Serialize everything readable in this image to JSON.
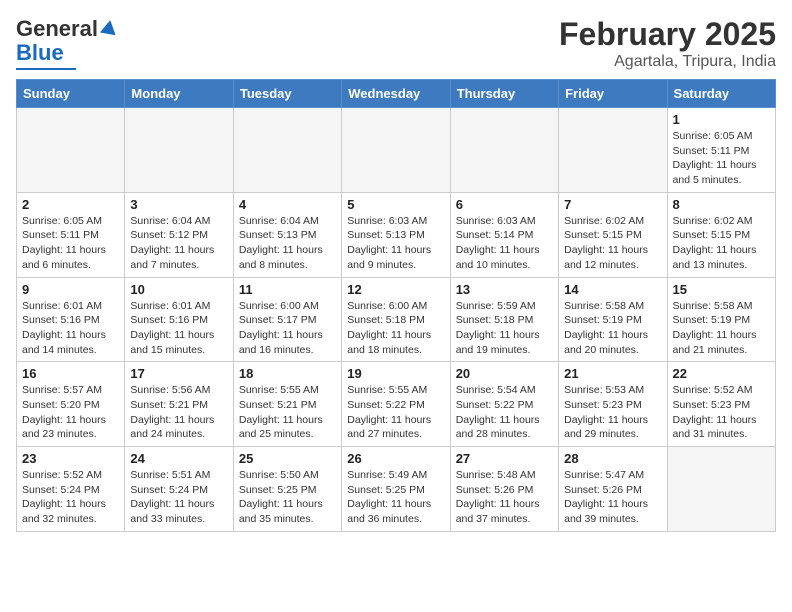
{
  "header": {
    "logo_general": "General",
    "logo_blue": "Blue",
    "month_year": "February 2025",
    "location": "Agartala, Tripura, India"
  },
  "weekdays": [
    "Sunday",
    "Monday",
    "Tuesday",
    "Wednesday",
    "Thursday",
    "Friday",
    "Saturday"
  ],
  "weeks": [
    [
      {
        "day": "",
        "info": ""
      },
      {
        "day": "",
        "info": ""
      },
      {
        "day": "",
        "info": ""
      },
      {
        "day": "",
        "info": ""
      },
      {
        "day": "",
        "info": ""
      },
      {
        "day": "",
        "info": ""
      },
      {
        "day": "1",
        "info": "Sunrise: 6:05 AM\nSunset: 5:11 PM\nDaylight: 11 hours and 5 minutes."
      }
    ],
    [
      {
        "day": "2",
        "info": "Sunrise: 6:05 AM\nSunset: 5:11 PM\nDaylight: 11 hours and 6 minutes."
      },
      {
        "day": "3",
        "info": "Sunrise: 6:04 AM\nSunset: 5:12 PM\nDaylight: 11 hours and 7 minutes."
      },
      {
        "day": "4",
        "info": "Sunrise: 6:04 AM\nSunset: 5:13 PM\nDaylight: 11 hours and 8 minutes."
      },
      {
        "day": "5",
        "info": "Sunrise: 6:03 AM\nSunset: 5:13 PM\nDaylight: 11 hours and 9 minutes."
      },
      {
        "day": "6",
        "info": "Sunrise: 6:03 AM\nSunset: 5:14 PM\nDaylight: 11 hours and 10 minutes."
      },
      {
        "day": "7",
        "info": "Sunrise: 6:02 AM\nSunset: 5:15 PM\nDaylight: 11 hours and 12 minutes."
      },
      {
        "day": "8",
        "info": "Sunrise: 6:02 AM\nSunset: 5:15 PM\nDaylight: 11 hours and 13 minutes."
      }
    ],
    [
      {
        "day": "9",
        "info": "Sunrise: 6:01 AM\nSunset: 5:16 PM\nDaylight: 11 hours and 14 minutes."
      },
      {
        "day": "10",
        "info": "Sunrise: 6:01 AM\nSunset: 5:16 PM\nDaylight: 11 hours and 15 minutes."
      },
      {
        "day": "11",
        "info": "Sunrise: 6:00 AM\nSunset: 5:17 PM\nDaylight: 11 hours and 16 minutes."
      },
      {
        "day": "12",
        "info": "Sunrise: 6:00 AM\nSunset: 5:18 PM\nDaylight: 11 hours and 18 minutes."
      },
      {
        "day": "13",
        "info": "Sunrise: 5:59 AM\nSunset: 5:18 PM\nDaylight: 11 hours and 19 minutes."
      },
      {
        "day": "14",
        "info": "Sunrise: 5:58 AM\nSunset: 5:19 PM\nDaylight: 11 hours and 20 minutes."
      },
      {
        "day": "15",
        "info": "Sunrise: 5:58 AM\nSunset: 5:19 PM\nDaylight: 11 hours and 21 minutes."
      }
    ],
    [
      {
        "day": "16",
        "info": "Sunrise: 5:57 AM\nSunset: 5:20 PM\nDaylight: 11 hours and 23 minutes."
      },
      {
        "day": "17",
        "info": "Sunrise: 5:56 AM\nSunset: 5:21 PM\nDaylight: 11 hours and 24 minutes."
      },
      {
        "day": "18",
        "info": "Sunrise: 5:55 AM\nSunset: 5:21 PM\nDaylight: 11 hours and 25 minutes."
      },
      {
        "day": "19",
        "info": "Sunrise: 5:55 AM\nSunset: 5:22 PM\nDaylight: 11 hours and 27 minutes."
      },
      {
        "day": "20",
        "info": "Sunrise: 5:54 AM\nSunset: 5:22 PM\nDaylight: 11 hours and 28 minutes."
      },
      {
        "day": "21",
        "info": "Sunrise: 5:53 AM\nSunset: 5:23 PM\nDaylight: 11 hours and 29 minutes."
      },
      {
        "day": "22",
        "info": "Sunrise: 5:52 AM\nSunset: 5:23 PM\nDaylight: 11 hours and 31 minutes."
      }
    ],
    [
      {
        "day": "23",
        "info": "Sunrise: 5:52 AM\nSunset: 5:24 PM\nDaylight: 11 hours and 32 minutes."
      },
      {
        "day": "24",
        "info": "Sunrise: 5:51 AM\nSunset: 5:24 PM\nDaylight: 11 hours and 33 minutes."
      },
      {
        "day": "25",
        "info": "Sunrise: 5:50 AM\nSunset: 5:25 PM\nDaylight: 11 hours and 35 minutes."
      },
      {
        "day": "26",
        "info": "Sunrise: 5:49 AM\nSunset: 5:25 PM\nDaylight: 11 hours and 36 minutes."
      },
      {
        "day": "27",
        "info": "Sunrise: 5:48 AM\nSunset: 5:26 PM\nDaylight: 11 hours and 37 minutes."
      },
      {
        "day": "28",
        "info": "Sunrise: 5:47 AM\nSunset: 5:26 PM\nDaylight: 11 hours and 39 minutes."
      },
      {
        "day": "",
        "info": ""
      }
    ]
  ]
}
